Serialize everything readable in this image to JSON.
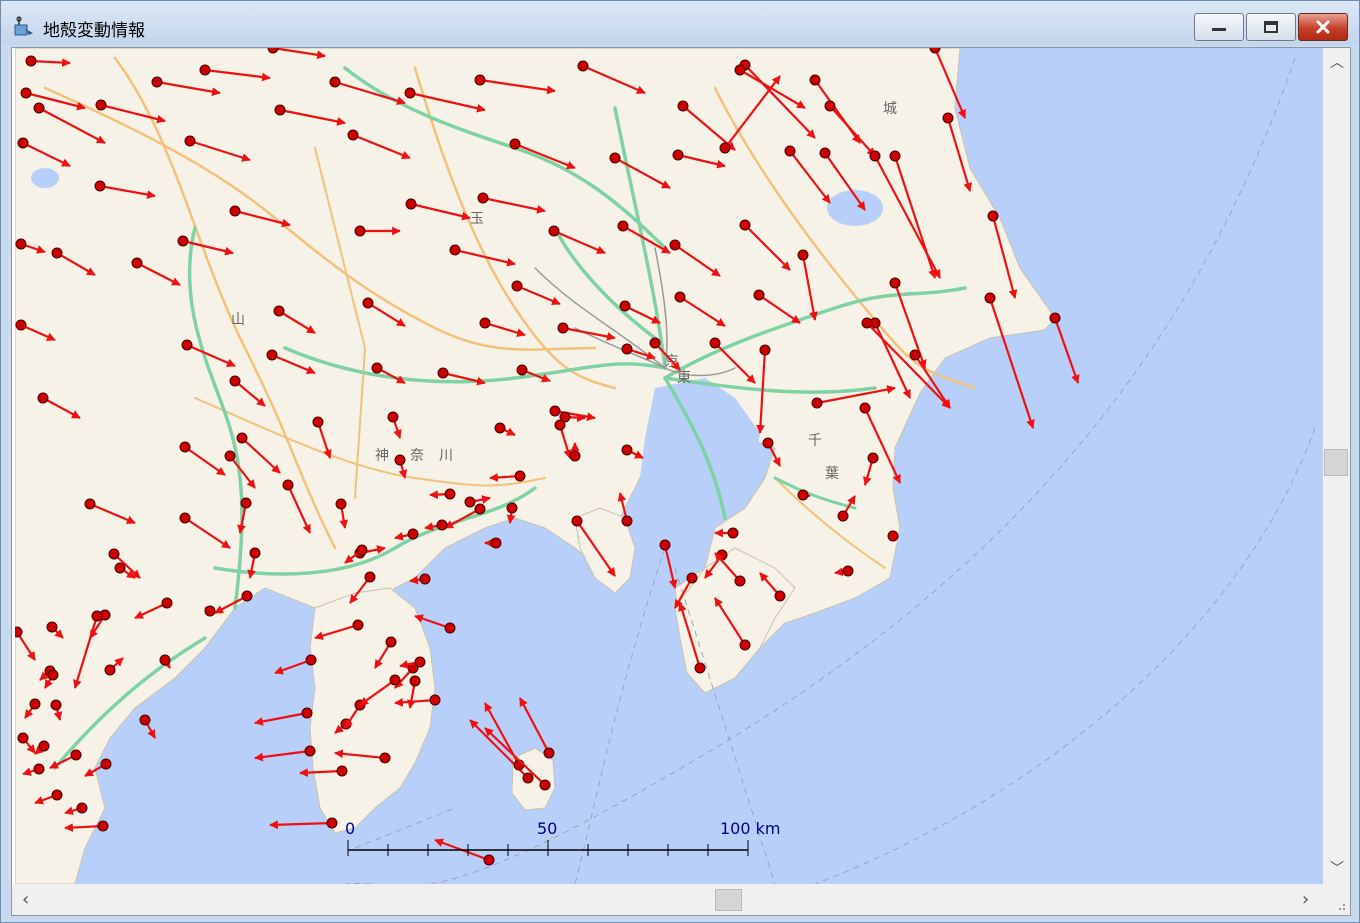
{
  "window": {
    "title": "地殻変動情報",
    "icon": "app-map-icon",
    "controls": {
      "minimize": "minimize-icon",
      "maximize": "maximize-icon",
      "close": "close-icon"
    }
  },
  "map": {
    "place_labels": [
      "城",
      "千",
      "東",
      "京",
      "山",
      "神",
      "奈",
      "川",
      "玉",
      "葉"
    ],
    "scale_bar": {
      "labels": [
        "0",
        "50",
        "100 km"
      ]
    },
    "colors": {
      "sea": "#b8cffa",
      "land": "#f6f2e8",
      "vector_arrow": "#ee1111",
      "station": "#cc0000",
      "expressway": "#7fd2a4",
      "road": "#f2c27a"
    }
  },
  "vectors": [
    [
      16,
      13,
      55,
      15
    ],
    [
      11,
      45,
      70,
      60
    ],
    [
      24,
      60,
      90,
      95
    ],
    [
      8,
      95,
      55,
      118
    ],
    [
      86,
      57,
      150,
      73
    ],
    [
      142,
      34,
      205,
      45
    ],
    [
      190,
      22,
      255,
      30
    ],
    [
      258,
      0,
      310,
      8
    ],
    [
      320,
      34,
      390,
      55
    ],
    [
      395,
      45,
      470,
      62
    ],
    [
      465,
      32,
      540,
      43
    ],
    [
      568,
      18,
      630,
      45
    ],
    [
      668,
      58,
      720,
      102
    ],
    [
      730,
      17,
      800,
      90
    ],
    [
      710,
      100,
      765,
      28
    ],
    [
      800,
      32,
      845,
      95
    ],
    [
      815,
      58,
      860,
      108
    ],
    [
      920,
      0,
      950,
      70
    ],
    [
      933,
      70,
      955,
      143
    ],
    [
      880,
      108,
      920,
      230
    ],
    [
      860,
      108,
      925,
      230
    ],
    [
      810,
      105,
      850,
      162
    ],
    [
      775,
      103,
      815,
      155
    ],
    [
      725,
      22,
      790,
      60
    ],
    [
      663,
      107,
      710,
      118
    ],
    [
      600,
      110,
      655,
      140
    ],
    [
      500,
      96,
      560,
      120
    ],
    [
      396,
      156,
      455,
      170
    ],
    [
      338,
      87,
      395,
      110
    ],
    [
      265,
      62,
      330,
      75
    ],
    [
      175,
      93,
      235,
      112
    ],
    [
      85,
      138,
      140,
      148
    ],
    [
      42,
      205,
      80,
      227
    ],
    [
      122,
      215,
      165,
      237
    ],
    [
      168,
      193,
      218,
      205
    ],
    [
      220,
      163,
      275,
      177
    ],
    [
      345,
      183,
      385,
      183
    ],
    [
      468,
      150,
      530,
      163
    ],
    [
      440,
      202,
      500,
      216
    ],
    [
      539,
      183,
      590,
      205
    ],
    [
      608,
      178,
      655,
      205
    ],
    [
      660,
      197,
      705,
      228
    ],
    [
      730,
      177,
      775,
      222
    ],
    [
      788,
      207,
      800,
      272
    ],
    [
      744,
      247,
      785,
      275
    ],
    [
      665,
      249,
      710,
      278
    ],
    [
      610,
      258,
      645,
      275
    ],
    [
      502,
      238,
      545,
      256
    ],
    [
      470,
      275,
      510,
      287
    ],
    [
      548,
      280,
      600,
      290
    ],
    [
      612,
      301,
      640,
      310
    ],
    [
      640,
      295,
      665,
      322
    ],
    [
      700,
      295,
      740,
      335
    ],
    [
      750,
      302,
      745,
      385
    ],
    [
      753,
      395,
      765,
      418
    ],
    [
      802,
      355,
      880,
      340
    ],
    [
      850,
      360,
      885,
      435
    ],
    [
      858,
      410,
      850,
      437
    ],
    [
      880,
      235,
      910,
      320
    ],
    [
      860,
      275,
      895,
      350
    ],
    [
      852,
      275,
      935,
      360
    ],
    [
      900,
      307,
      935,
      360
    ],
    [
      975,
      250,
      1018,
      380
    ],
    [
      1040,
      270,
      1063,
      335
    ],
    [
      978,
      168,
      1000,
      250
    ],
    [
      353,
      255,
      390,
      278
    ],
    [
      264,
      263,
      300,
      285
    ],
    [
      172,
      297,
      220,
      318
    ],
    [
      257,
      307,
      300,
      325
    ],
    [
      220,
      333,
      250,
      358
    ],
    [
      362,
      320,
      390,
      335
    ],
    [
      428,
      325,
      470,
      335
    ],
    [
      507,
      322,
      535,
      333
    ],
    [
      540,
      363,
      580,
      370
    ],
    [
      550,
      369,
      570,
      370
    ],
    [
      378,
      369,
      385,
      390
    ],
    [
      303,
      374,
      315,
      410
    ],
    [
      227,
      390,
      265,
      425
    ],
    [
      170,
      399,
      210,
      427
    ],
    [
      215,
      408,
      240,
      440
    ],
    [
      231,
      455,
      225,
      485
    ],
    [
      170,
      470,
      215,
      500
    ],
    [
      273,
      437,
      295,
      485
    ],
    [
      326,
      456,
      330,
      480
    ],
    [
      385,
      412,
      390,
      430
    ],
    [
      485,
      380,
      500,
      387
    ],
    [
      435,
      446,
      415,
      447
    ],
    [
      455,
      454,
      475,
      450
    ],
    [
      465,
      461,
      430,
      480
    ],
    [
      505,
      428,
      475,
      430
    ],
    [
      497,
      460,
      495,
      475
    ],
    [
      545,
      377,
      555,
      410
    ],
    [
      560,
      408,
      560,
      395
    ],
    [
      612,
      402,
      628,
      410
    ],
    [
      612,
      473,
      605,
      445
    ],
    [
      562,
      473,
      600,
      528
    ],
    [
      650,
      497,
      660,
      540
    ],
    [
      677,
      530,
      660,
      560
    ],
    [
      707,
      507,
      690,
      530
    ],
    [
      718,
      485,
      700,
      485
    ],
    [
      725,
      533,
      700,
      505
    ],
    [
      765,
      548,
      745,
      525
    ],
    [
      730,
      597,
      700,
      550
    ],
    [
      685,
      620,
      665,
      555
    ],
    [
      788,
      447,
      795,
      448
    ],
    [
      828,
      468,
      840,
      448
    ],
    [
      833,
      523,
      820,
      525
    ],
    [
      878,
      488,
      877,
      483
    ],
    [
      398,
      486,
      380,
      490
    ],
    [
      345,
      505,
      370,
      500
    ],
    [
      427,
      477,
      410,
      480
    ],
    [
      410,
      531,
      395,
      533
    ],
    [
      347,
      502,
      330,
      515
    ],
    [
      355,
      529,
      335,
      555
    ],
    [
      343,
      577,
      300,
      590
    ],
    [
      296,
      612,
      260,
      625
    ],
    [
      292,
      665,
      240,
      675
    ],
    [
      295,
      703,
      240,
      710
    ],
    [
      331,
      676,
      320,
      685
    ],
    [
      345,
      657,
      330,
      680
    ],
    [
      370,
      710,
      320,
      705
    ],
    [
      376,
      594,
      360,
      620
    ],
    [
      398,
      620,
      380,
      640
    ],
    [
      380,
      632,
      345,
      657
    ],
    [
      405,
      614,
      385,
      618
    ],
    [
      400,
      633,
      395,
      660
    ],
    [
      420,
      652,
      380,
      655
    ],
    [
      435,
      580,
      400,
      568
    ],
    [
      481,
      495,
      470,
      495
    ],
    [
      327,
      723,
      285,
      725
    ],
    [
      317,
      775,
      255,
      777
    ],
    [
      474,
      812,
      420,
      792
    ],
    [
      513,
      730,
      455,
      672
    ],
    [
      504,
      717,
      470,
      655
    ],
    [
      534,
      705,
      505,
      650
    ],
    [
      530,
      737,
      470,
      680
    ],
    [
      232,
      548,
      200,
      565
    ],
    [
      240,
      505,
      235,
      530
    ],
    [
      152,
      555,
      120,
      570
    ],
    [
      150,
      612,
      155,
      620
    ],
    [
      195,
      563,
      190,
      560
    ],
    [
      105,
      520,
      120,
      530
    ],
    [
      90,
      567,
      75,
      590
    ],
    [
      95,
      622,
      108,
      610
    ],
    [
      130,
      672,
      140,
      690
    ],
    [
      82,
      568,
      60,
      640
    ],
    [
      37,
      579,
      48,
      590
    ],
    [
      35,
      623,
      25,
      632
    ],
    [
      41,
      657,
      45,
      672
    ],
    [
      29,
      698,
      20,
      706
    ],
    [
      61,
      707,
      35,
      720
    ],
    [
      91,
      716,
      70,
      728
    ],
    [
      24,
      721,
      8,
      726
    ],
    [
      42,
      747,
      20,
      755
    ],
    [
      67,
      760,
      50,
      765
    ],
    [
      88,
      778,
      50,
      780
    ],
    [
      38,
      627,
      30,
      640
    ],
    [
      2,
      584,
      20,
      612
    ],
    [
      20,
      656,
      10,
      670
    ],
    [
      8,
      690,
      20,
      705
    ],
    [
      99,
      506,
      125,
      530
    ],
    [
      75,
      456,
      120,
      475
    ],
    [
      28,
      350,
      65,
      370
    ],
    [
      6,
      277,
      40,
      292
    ],
    [
      6,
      196,
      30,
      204
    ]
  ]
}
